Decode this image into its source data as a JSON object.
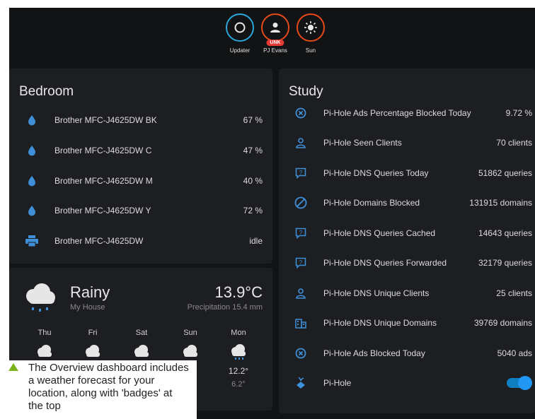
{
  "badges": [
    {
      "name": "Updater",
      "label": "Updater",
      "icon": "circle-icon",
      "color": "#2aa6d8"
    },
    {
      "name": "PJ Evans",
      "label": "PJ Evans",
      "icon": "person-icon",
      "color": "#e64a19",
      "status": "UNK"
    },
    {
      "name": "Sun",
      "label": "Sun",
      "icon": "sun-icon",
      "color": "#e64a19"
    }
  ],
  "bedroom": {
    "title": "Bedroom",
    "rows": [
      {
        "icon": "water-drop-icon",
        "name": "Brother MFC-J4625DW BK",
        "value": "67 %"
      },
      {
        "icon": "water-drop-icon",
        "name": "Brother MFC-J4625DW C",
        "value": "47 %"
      },
      {
        "icon": "water-drop-icon",
        "name": "Brother MFC-J4625DW M",
        "value": "40 %"
      },
      {
        "icon": "water-drop-icon",
        "name": "Brother MFC-J4625DW Y",
        "value": "72 %"
      },
      {
        "icon": "printer-icon",
        "name": "Brother MFC-J4625DW",
        "value": "idle"
      }
    ]
  },
  "weather": {
    "condition": "Rainy",
    "location": "My House",
    "temperature": "13.9°C",
    "precipitation": "Precipitation 15.4 mm",
    "forecast": [
      {
        "day": "Thu",
        "high": "",
        "low": ""
      },
      {
        "day": "Fri",
        "high": "",
        "low": ""
      },
      {
        "day": "Sat",
        "high": "",
        "low": ""
      },
      {
        "day": "Sun",
        "high": "°",
        "low": ""
      },
      {
        "day": "Mon",
        "high": "12.2°",
        "low": "6.2°"
      }
    ]
  },
  "study": {
    "title": "Study",
    "rows": [
      {
        "icon": "close-circle-icon",
        "name": "Pi-Hole Ads Percentage Blocked Today",
        "value": "9.72 %"
      },
      {
        "icon": "account-icon",
        "name": "Pi-Hole Seen Clients",
        "value": "70 clients"
      },
      {
        "icon": "comment-question-icon",
        "name": "Pi-Hole DNS Queries Today",
        "value": "51862 queries"
      },
      {
        "icon": "block-icon",
        "name": "Pi-Hole Domains Blocked",
        "value": "131915 domains"
      },
      {
        "icon": "comment-question-icon",
        "name": "Pi-Hole DNS Queries Cached",
        "value": "14643 queries"
      },
      {
        "icon": "comment-question-icon",
        "name": "Pi-Hole DNS Queries Forwarded",
        "value": "32179 queries"
      },
      {
        "icon": "account-icon",
        "name": "Pi-Hole DNS Unique Clients",
        "value": "25 clients"
      },
      {
        "icon": "domain-icon",
        "name": "Pi-Hole DNS Unique Domains",
        "value": "39769 domains"
      },
      {
        "icon": "close-circle-icon",
        "name": "Pi-Hole Ads Blocked Today",
        "value": "5040 ads"
      },
      {
        "icon": "pi-hole-icon",
        "name": "Pi-Hole",
        "value": ""
      }
    ]
  },
  "colors": {
    "accent": "#2196f3",
    "icon_blue": "#3f8fd9",
    "background": "#111315",
    "card": "#1c1e21",
    "caption_triangle": "#7cb31a"
  },
  "caption": {
    "text": "The Overview dashboard includes a weather forecast for your location, along with 'badges' at the top"
  }
}
